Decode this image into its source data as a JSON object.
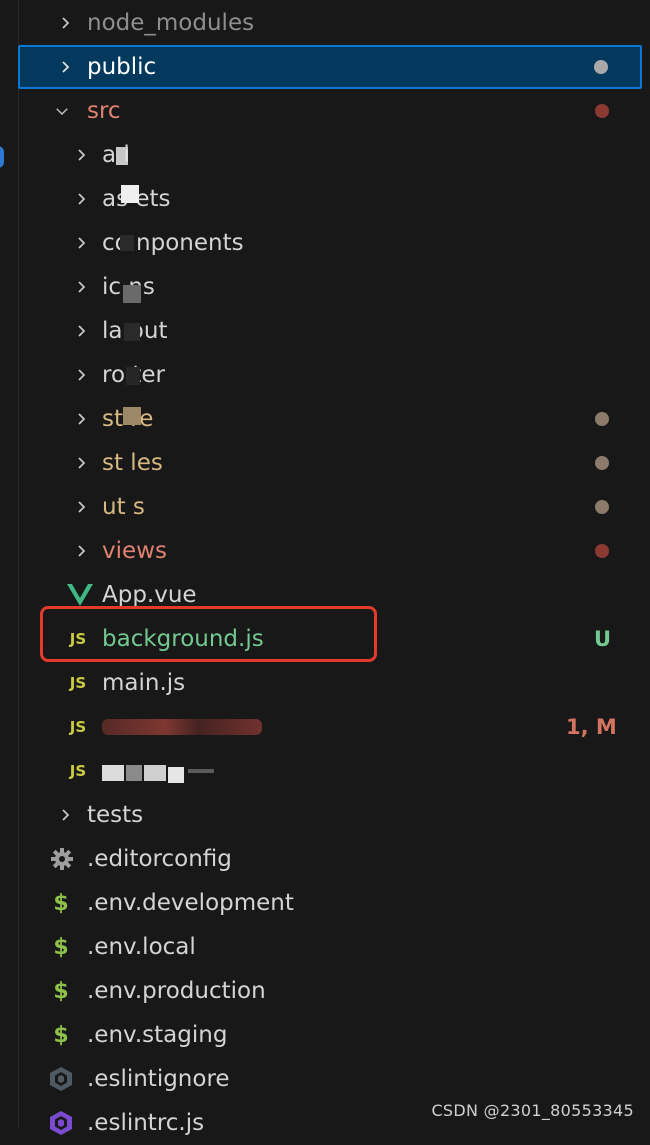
{
  "colors": {
    "default_text": "#d4d4d4",
    "folder_modified": "#d7b981",
    "folder_error": "#e0826f",
    "untracked_green": "#73c991",
    "dot_grey": "#8c7b6a",
    "dot_red": "#8b3a32",
    "selection_bg": "#04395e",
    "selection_border": "#0a78d4",
    "annotation_red": "#e23b2c"
  },
  "tree": {
    "node_modules": "node_modules",
    "public": "public",
    "src": "src",
    "api": "a i",
    "assets": "as ets",
    "components": "co nponents",
    "icons": "ic ns",
    "layout": "la out",
    "router": "ro ter",
    "store": "st re",
    "styles": "st les",
    "utils": "ut s",
    "views": "views",
    "app_vue": "App.vue",
    "background_js": "background.js",
    "background_status": "U",
    "main_js": "main.js",
    "permission_status": "1, M",
    "tests": "tests",
    "editorconfig": ".editorconfig",
    "env_development": ".env.development",
    "env_local": ".env.local",
    "env_production": ".env.production",
    "env_staging": ".env.staging",
    "eslintignore": ".eslintignore",
    "eslintrc": ".eslintrc.js"
  },
  "icons": {
    "chevron_right": "chevron-right-icon",
    "chevron_down": "chevron-down-icon",
    "js": "JS",
    "vue": "vue-icon",
    "gear": "gear-icon",
    "dollar": "$",
    "eslintignore": "eslint-circle-icon",
    "eslintrc": "eslint-hex-icon"
  },
  "watermark": "CSDN @2301_80553345"
}
